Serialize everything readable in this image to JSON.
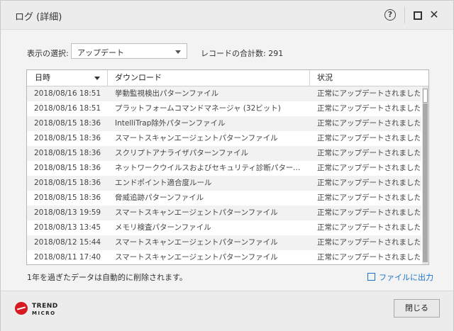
{
  "window": {
    "title": "ログ (詳細)"
  },
  "titlebar": {
    "help_glyph": "?",
    "close_glyph": "✕"
  },
  "filter": {
    "label": "表示の選択:",
    "selected": "アップデート"
  },
  "record_count": {
    "label": "レコードの合計数:",
    "value": "291"
  },
  "table": {
    "columns": [
      "日時",
      "ダウンロード",
      "状況"
    ],
    "rows": [
      [
        "2018/08/16 18:51",
        "挙動監視検出パターンファイル",
        "正常にアップデートされました"
      ],
      [
        "2018/08/16 18:51",
        "プラットフォームコマンドマネージャ (32ビット)",
        "正常にアップデートされました"
      ],
      [
        "2018/08/15 18:36",
        "IntelliTrap除外パターンファイル",
        "正常にアップデートされました"
      ],
      [
        "2018/08/15 18:36",
        "スマートスキャンエージェントパターンファイル",
        "正常にアップデートされました"
      ],
      [
        "2018/08/15 18:36",
        "スクリプトアナライザパターンファイル",
        "正常にアップデートされました"
      ],
      [
        "2018/08/15 18:36",
        "ネットワークウイルスおよびセキュリティ診断パターン...",
        "正常にアップデートされました"
      ],
      [
        "2018/08/15 18:36",
        "エンドポイント適合度ルール",
        "正常にアップデートされました"
      ],
      [
        "2018/08/15 18:36",
        "脅威追跡パターンファイル",
        "正常にアップデートされました"
      ],
      [
        "2018/08/13 19:59",
        "スマートスキャンエージェントパターンファイル",
        "正常にアップデートされました"
      ],
      [
        "2018/08/13 13:45",
        "メモリ検査パターンファイル",
        "正常にアップデートされました"
      ],
      [
        "2018/08/12 15:44",
        "スマートスキャンエージェントパターンファイル",
        "正常にアップデートされました"
      ],
      [
        "2018/08/11 17:40",
        "スマートスキャンエージェントパターンファイル",
        "正常にアップデートされました"
      ]
    ]
  },
  "note": "1年を過ぎたデータは自動的に削除されます。",
  "export_label": "ファイルに出力",
  "logo": {
    "line1": "TREND",
    "line2": "MICRO"
  },
  "close_button": "閉じる"
}
